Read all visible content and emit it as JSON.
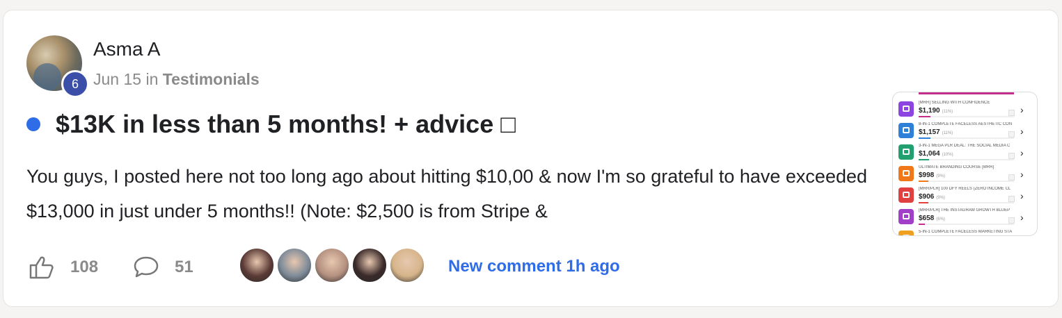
{
  "post": {
    "author": "Asma A",
    "level": "6",
    "date": "Jun 15",
    "in_word": "in",
    "category": "Testimonials",
    "title": "$13K in less than 5 months! + advice □",
    "body": "You guys, I posted here not too long ago about hitting $10,00 & now I'm so grateful to have exceeded $13,000 in just under 5 months!! (Note: $2,500 is from Stripe &",
    "likes": "108",
    "comments": "51",
    "new_comment": "New comment 1h ago"
  },
  "colors": {
    "unread_dot": "#2f6de8",
    "level_badge": "#3b4fa8",
    "link": "#2f6de8"
  },
  "commenters": [
    {
      "name": "commenter-avatar-1",
      "color": "#5a3a35"
    },
    {
      "name": "commenter-avatar-2",
      "color": "#7d8a98"
    },
    {
      "name": "commenter-avatar-3",
      "color": "#b49080"
    },
    {
      "name": "commenter-avatar-4",
      "color": "#3a2a2a"
    },
    {
      "name": "commenter-avatar-5",
      "color": "#d6b48a"
    }
  ],
  "thumbnail": {
    "rows": [
      {
        "name": "[MRR] SELLING WITH CONFIDENCE",
        "price": "$1,190",
        "pct": "(11%)",
        "icon_color": "#8e44e0",
        "bar_color": "#c0308a",
        "fill": 0.11
      },
      {
        "name": "8-IN-1 COMPLETE FACELESS AESTHETIC CON",
        "price": "$1,157",
        "pct": "(11%)",
        "icon_color": "#2f80d8",
        "bar_color": "#2f80d8",
        "fill": 0.11
      },
      {
        "name": "3-IN-1 MEGA PLR DEAL: THE SOCIAL MEDIA C",
        "price": "$1,064",
        "pct": "(10%)",
        "icon_color": "#23a070",
        "bar_color": "#23a070",
        "fill": 0.1
      },
      {
        "name": "ULTIMATE BRANDING COURSE [MRR]",
        "price": "$998",
        "pct": "(9%)",
        "icon_color": "#f07818",
        "bar_color": "#f07818",
        "fill": 0.09
      },
      {
        "name": "[MRR/PLR] 100 DFY REELS (ZERO INCOME CL",
        "price": "$906",
        "pct": "(9%)",
        "icon_color": "#e04040",
        "bar_color": "#e04040",
        "fill": 0.09
      },
      {
        "name": "[MRR/PLR] THE INSTAGRAM GROWTH BLUEP",
        "price": "$658",
        "pct": "(6%)",
        "icon_color": "#a040c8",
        "bar_color": "#c0308a",
        "fill": 0.06
      },
      {
        "name": "5-IN-1 COMPLETE FACELESS MARKETING STA",
        "price": "",
        "pct": "",
        "icon_color": "#f0a020",
        "bar_color": "#f0a020",
        "fill": 0.0
      }
    ]
  }
}
